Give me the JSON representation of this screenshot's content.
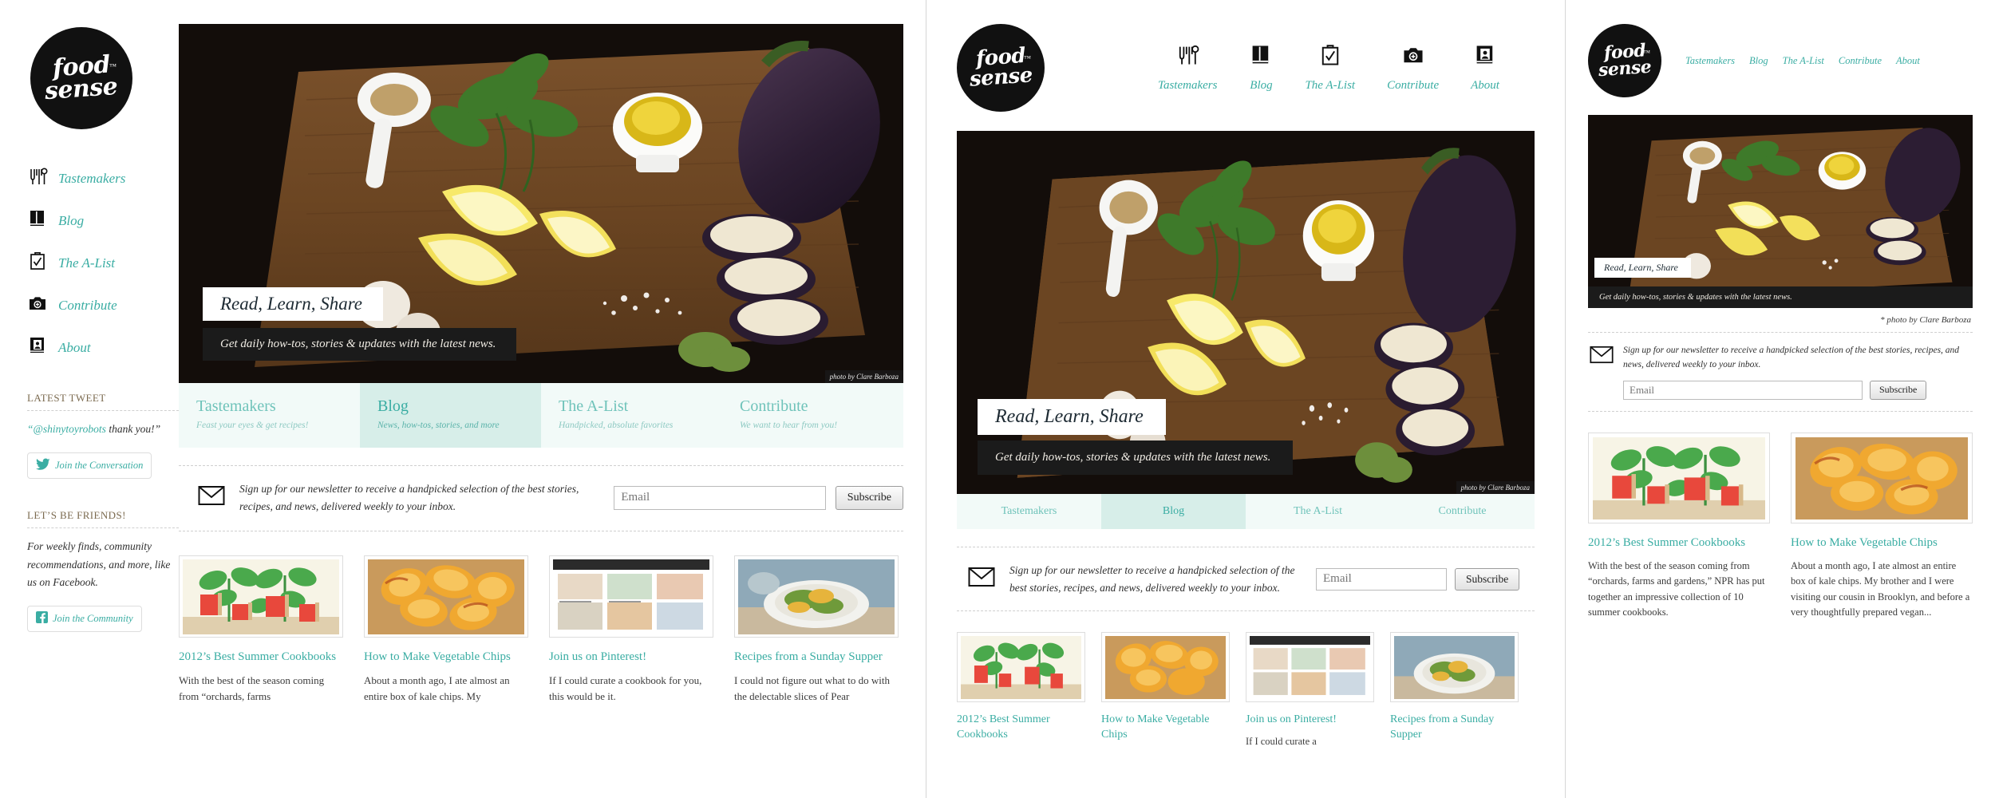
{
  "brand": {
    "line1": "food",
    "line2": "sense",
    "tm": "™"
  },
  "nav": {
    "items": [
      {
        "label": "Tastemakers",
        "icon": "cutlery-icon"
      },
      {
        "label": "Blog",
        "icon": "book-icon"
      },
      {
        "label": "The A-List",
        "icon": "clipboard-check-icon"
      },
      {
        "label": "Contribute",
        "icon": "camera-icon"
      },
      {
        "label": "About",
        "icon": "profile-book-icon"
      }
    ]
  },
  "hero": {
    "title": "Read, Learn, Share",
    "subtitle": "Get daily how-tos, stories & updates with the latest news.",
    "credit": "photo by Clare Barboza",
    "credit_mobile": "* photo by Clare Barboza"
  },
  "tabs": [
    {
      "title": "Tastemakers",
      "sub": "Feast your eyes & get recipes!",
      "active": false
    },
    {
      "title": "Blog",
      "sub": "News, how-tos, stories, and more",
      "active": true
    },
    {
      "title": "The A-List",
      "sub": "Handpicked, absolute favorites",
      "active": false
    },
    {
      "title": "Contribute",
      "sub": "We want to hear from you!",
      "active": false
    }
  ],
  "newsletter": {
    "icon": "envelope-icon",
    "text_desktop": "Sign up for our newsletter to receive a handpicked selection of the best stories, recipes, and news, delivered weekly to your inbox.",
    "text_tablet": "Sign up for our newsletter to receive a handpicked selection of the best stories, recipes, and news, delivered weekly to your inbox.",
    "text_mobile": "Sign up for our newsletter to receive a handpicked selection of the best stories, recipes, and news, delivered weekly to your inbox.",
    "placeholder": "Email",
    "button": "Subscribe"
  },
  "sidebar": {
    "tweet_heading": "LATEST TWEET",
    "tweet_text": "“@shinytoyrobots thank you!”",
    "tweet_button": "Join the Conversation",
    "friends_heading": "LET’S BE FRIENDS!",
    "friends_text": "For weekly finds, community recommendations, and more, like us on Facebook.",
    "friends_button": "Join the Community",
    "twitter_icon": "twitter-bird-icon",
    "facebook_icon": "facebook-icon"
  },
  "cards": [
    {
      "title": "2012’s Best Summer Cookbooks",
      "excerpt_short": "With the best of the season coming from “orchards, farms",
      "excerpt_full": "With the best of the season coming from “orchards, farms and gardens,” NPR has put together an impressive collection of 10 summer cookbooks.",
      "thumb": "plants-illustration"
    },
    {
      "title": "How to Make Vegetable Chips",
      "excerpt_short": "About a month ago, I ate almost an entire box of kale chips. My",
      "excerpt_full": "About a month ago, I ate almost an entire box of kale chips. My brother and I were visiting our cousin in Brooklyn, and before a very thoughtfully prepared vegan...",
      "thumb": "veggie-chips-photo"
    },
    {
      "title": "Join us on Pinterest!",
      "excerpt_short": "If I could curate a cookbook for you, this would be it.",
      "excerpt_mobile": "If I could curate a",
      "excerpt_full": "If I could curate a cookbook for you, this would be it.",
      "thumb": "pinterest-screenshot"
    },
    {
      "title": "Recipes from a Sunday Supper",
      "excerpt_short": "I could not figure out what to do with the delectable slices of Pear",
      "excerpt_full": "I could not figure out what to do with the delectable slices of Pear",
      "thumb": "sunday-supper-photo"
    }
  ],
  "colors": {
    "accent": "#3aada3",
    "tab_active_bg": "#d7eee9",
    "tab_bg": "#f2faf8",
    "heading_brown": "#7b6a4f"
  }
}
